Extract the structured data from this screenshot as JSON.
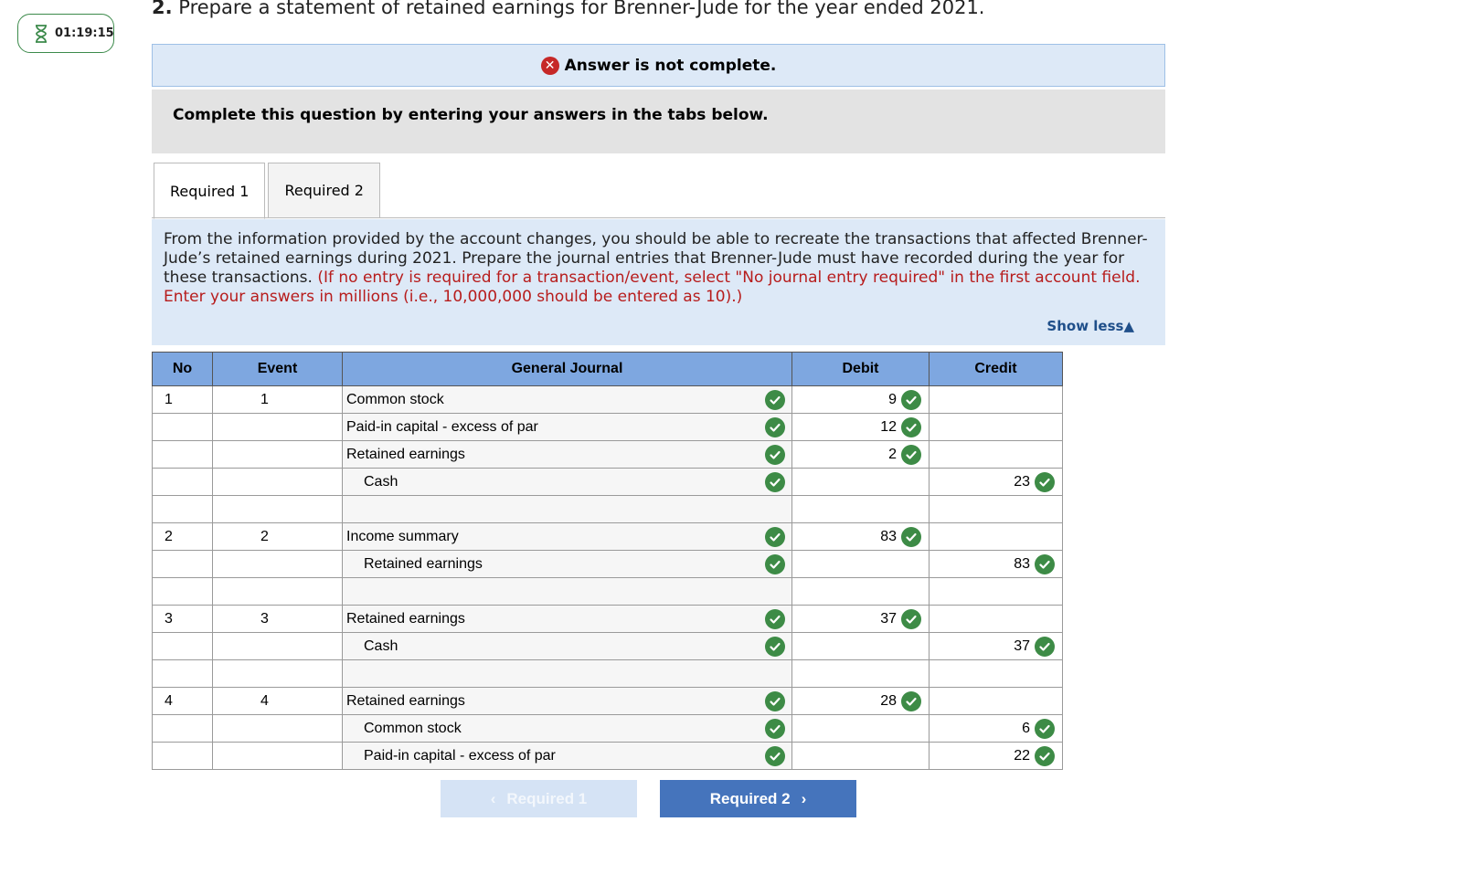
{
  "timer": {
    "time": "01:19:15",
    "icon": "hourglass-icon"
  },
  "question": {
    "number": "2.",
    "text": "Prepare a statement of retained earnings for Brenner-Jude for the year ended 2021."
  },
  "banner": {
    "text": "Answer is not complete.",
    "icon": "x-circle-icon",
    "color": "#c62828"
  },
  "instructions": "Complete this question by entering your answers in the tabs below.",
  "tabs": [
    {
      "label": "Required 1",
      "active": true
    },
    {
      "label": "Required 2",
      "active": false
    }
  ],
  "prompt": {
    "text": "From the information provided by the account changes, you should be able to recreate the transactions that affected Brenner-Jude’s retained earnings during 2021. Prepare the journal entries that Brenner-Jude must have recorded during the year for these transactions.",
    "note": "(If no entry is required for a transaction/event, select \"No journal entry required\" in the first account field. Enter your answers in millions (i.e., 10,000,000 should be entered as 10).)",
    "show_less": "Show less▲"
  },
  "table": {
    "headers": [
      "No",
      "Event",
      "General Journal",
      "Debit",
      "Credit"
    ],
    "rows": [
      {
        "no": "1",
        "event": "1",
        "account": "Common stock",
        "indent": false,
        "debit": "9",
        "credit": ""
      },
      {
        "no": "",
        "event": "",
        "account": "Paid-in capital - excess of par",
        "indent": false,
        "debit": "12",
        "credit": ""
      },
      {
        "no": "",
        "event": "",
        "account": "Retained earnings",
        "indent": false,
        "debit": "2",
        "credit": ""
      },
      {
        "no": "",
        "event": "",
        "account": "Cash",
        "indent": true,
        "debit": "",
        "credit": "23"
      },
      {
        "no": "",
        "event": "",
        "account": "",
        "indent": false,
        "debit": "",
        "credit": ""
      },
      {
        "no": "2",
        "event": "2",
        "account": "Income summary",
        "indent": false,
        "debit": "83",
        "credit": ""
      },
      {
        "no": "",
        "event": "",
        "account": "Retained earnings",
        "indent": true,
        "debit": "",
        "credit": "83"
      },
      {
        "no": "",
        "event": "",
        "account": "",
        "indent": false,
        "debit": "",
        "credit": ""
      },
      {
        "no": "3",
        "event": "3",
        "account": "Retained earnings",
        "indent": false,
        "debit": "37",
        "credit": ""
      },
      {
        "no": "",
        "event": "",
        "account": "Cash",
        "indent": true,
        "debit": "",
        "credit": "37"
      },
      {
        "no": "",
        "event": "",
        "account": "",
        "indent": false,
        "debit": "",
        "credit": ""
      },
      {
        "no": "4",
        "event": "4",
        "account": "Retained earnings",
        "indent": false,
        "debit": "28",
        "credit": ""
      },
      {
        "no": "",
        "event": "",
        "account": "Common stock",
        "indent": true,
        "debit": "",
        "credit": "6"
      },
      {
        "no": "",
        "event": "",
        "account": "Paid-in capital - excess of par",
        "indent": true,
        "debit": "",
        "credit": "22"
      }
    ]
  },
  "nav": {
    "prev": "Required 1",
    "next": "Required 2"
  },
  "colors": {
    "header_blue": "#7ea7e0",
    "check_green": "#3d8b46",
    "nav_blue": "#4574bc"
  }
}
